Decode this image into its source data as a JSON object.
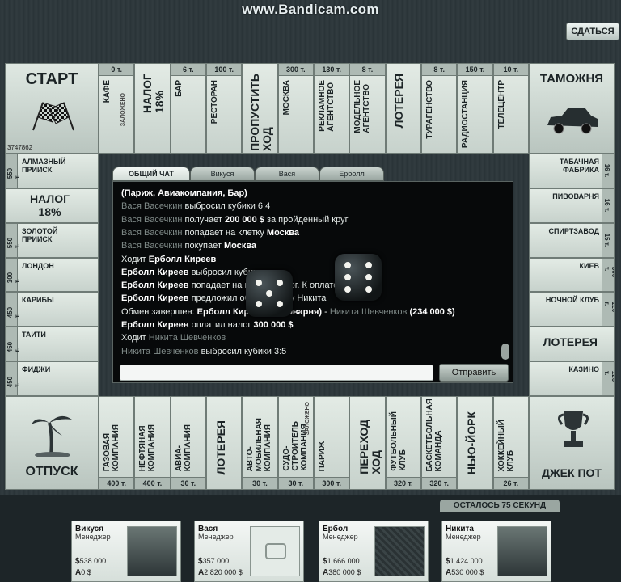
{
  "watermark": "www.Bandicam.com",
  "surrender_label": "СДАТЬСЯ",
  "corners": {
    "start": "СТАРТ",
    "start_counter": "3747862",
    "customs": "ТАМОЖНЯ",
    "vacation": "ОТПУСК",
    "jackpot": "ДЖЕК ПОТ"
  },
  "top_cells": [
    {
      "price": "0 т.",
      "name": "КАФЕ",
      "note": "ЗАЛОЖЕНО"
    },
    {
      "price": "",
      "name": "НАЛОГ\n18%"
    },
    {
      "price": "6 т.",
      "name": "БАР"
    },
    {
      "price": "100 т.",
      "name": "РЕСТОРАН"
    },
    {
      "price": "",
      "name": "ПРОПУСТИТЬ\nХОД"
    },
    {
      "price": "300 т.",
      "name": "МОСКВА"
    },
    {
      "price": "130 т.",
      "name": "РЕКЛАМНОЕ\nАГЕНТСТВО"
    },
    {
      "price": "8 т.",
      "name": "МОДЕЛЬНОЕ\nАГЕНТСТВО"
    },
    {
      "price": "",
      "name": "ЛОТЕРЕЯ"
    },
    {
      "price": "8 т.",
      "name": "ТУРАГЕНСТВО"
    },
    {
      "price": "150 т.",
      "name": "РАДИОСТАНЦИЯ"
    },
    {
      "price": "10 т.",
      "name": "ТЕЛЕЦЕНТР"
    }
  ],
  "left_cells": [
    {
      "price": "550 т.",
      "name": "АЛМАЗНЫЙ\nПРИИСК"
    },
    {
      "price": "",
      "name": "НАЛОГ\n18%"
    },
    {
      "price": "550 т.",
      "name": "ЗОЛОТОЙ\nПРИИСК"
    },
    {
      "price": "300 т.",
      "name": "ЛОНДОН"
    },
    {
      "price": "450 т.",
      "name": "КАРИБЫ"
    },
    {
      "price": "450 т.",
      "name": "ТАИТИ"
    },
    {
      "price": "450 т.",
      "name": "ФИДЖИ"
    }
  ],
  "right_cells": [
    {
      "price": "16 т.",
      "name": "ТАБАЧНАЯ\nФАБРИКА"
    },
    {
      "price": "16 т.",
      "name": "ПИВОВАРНЯ"
    },
    {
      "price": "15 т.",
      "name": "СПИРТЗАВОД"
    },
    {
      "price": "300 т.",
      "name": "КИЕВ"
    },
    {
      "price": "120 т.",
      "name": "НОЧНОЙ КЛУБ"
    },
    {
      "price": "",
      "name": "ЛОТЕРЕЯ"
    },
    {
      "price": "120 т.",
      "name": "КАЗИНО"
    }
  ],
  "bottom_cells": [
    {
      "price": "400 т.",
      "name": "ГАЗОВАЯ\nКОМПАНИЯ"
    },
    {
      "price": "400 т.",
      "name": "НЕФТЯНАЯ\nКОМПАНИЯ"
    },
    {
      "price": "30 т.",
      "name": "АВИА-\nКОМПАНИЯ"
    },
    {
      "price": "",
      "name": "ЛОТЕРЕЯ"
    },
    {
      "price": "30 т.",
      "name": "АВТО-\nМОБИЛЬНАЯ\nКОМПАНИЯ"
    },
    {
      "price": "30 т.",
      "name": "СУДО-\nСТРОИТЕЛЬ\nКОМПАНИЯ",
      "note": "ЗАЛОЖЕНО"
    },
    {
      "price": "300 т.",
      "name": "ПАРИЖ"
    },
    {
      "price": "",
      "name": "ПЕРЕХОД\nХОД"
    },
    {
      "price": "320 т.",
      "name": "ФУТБОЛЬНЫЙ\nКЛУБ"
    },
    {
      "price": "320 т.",
      "name": "БАСКЕТБОЛЬНАЯ\nКОМАНДА"
    },
    {
      "price": "",
      "name": "НЬЮ-ЙОРК"
    },
    {
      "price": "26 т.",
      "name": "ХОККЕЙНЫЙ\nКЛУБ"
    }
  ],
  "chat": {
    "tabs": [
      "ОБЩИЙ ЧАТ",
      "Викуся",
      "Вася",
      "Ерболл"
    ],
    "messages": [
      {
        "parts": [
          [
            "b",
            "(Париж, Авиакомпания, Бар)"
          ]
        ]
      },
      {
        "parts": [
          [
            "g",
            "Вася Васечкин "
          ],
          [
            "n",
            "выбросил кубики 6:4"
          ]
        ]
      },
      {
        "parts": [
          [
            "g",
            "Вася Васечкин "
          ],
          [
            "n",
            "получает "
          ],
          [
            "b",
            "200 000 $"
          ],
          [
            "n",
            " за пройденный круг"
          ]
        ]
      },
      {
        "parts": [
          [
            "g",
            "Вася Васечкин "
          ],
          [
            "n",
            "попадает на клетку "
          ],
          [
            "b",
            "Москва"
          ]
        ]
      },
      {
        "parts": [
          [
            "g",
            "Вася Васечкин "
          ],
          [
            "n",
            "покупает "
          ],
          [
            "b",
            "Москва"
          ]
        ]
      },
      {
        "parts": [
          [
            "n",
            "Ходит "
          ],
          [
            "b",
            "Ерболл Киреев"
          ]
        ]
      },
      {
        "parts": [
          [
            "b",
            "Ерболл Киреев"
          ],
          [
            "n",
            " выбросил кубики"
          ]
        ]
      },
      {
        "parts": [
          [
            "b",
            "Ерболл Киреев"
          ],
          [
            "n",
            " попадает на клетку Налог. К оплате $"
          ]
        ]
      },
      {
        "parts": [
          [
            "b",
            "Ерболл Киреев"
          ],
          [
            "n",
            " предложил обмен игроку Никита"
          ]
        ]
      },
      {
        "parts": [
          [
            "n",
            "Обмен завершен: "
          ],
          [
            "b",
            "Ерболл Киреев (Пивоварня)"
          ],
          [
            "n",
            " - "
          ],
          [
            "g",
            "Никита Шевченков "
          ],
          [
            "b",
            "(234 000 $)"
          ]
        ]
      },
      {
        "parts": [
          [
            "b",
            "Ерболл Киреев"
          ],
          [
            "n",
            " оплатил налог "
          ],
          [
            "b",
            "300 000 $"
          ]
        ]
      },
      {
        "parts": [
          [
            "n",
            "Ходит "
          ],
          [
            "g",
            "Никита Шевченков"
          ]
        ]
      },
      {
        "parts": [
          [
            "g",
            "Никита Шевченков "
          ],
          [
            "n",
            "выбросил кубики 3:5"
          ]
        ]
      }
    ],
    "input_placeholder": "",
    "send_label": "Отправить"
  },
  "dice": [
    5,
    6
  ],
  "timer": "ОСТАЛОСЬ 75 СЕКУНД",
  "players": [
    {
      "name": "Викуся",
      "role": "Менеджер",
      "money": "538 000",
      "assets": "0 $"
    },
    {
      "name": "Вася",
      "role": "Менеджер",
      "money": "357 000",
      "assets": "2 820 000 $"
    },
    {
      "name": "Ербол",
      "role": "Менеджер",
      "money": "1 666 000",
      "assets": "380 000 $"
    },
    {
      "name": "Никита",
      "role": "Менеджер",
      "money": "1 424 000",
      "assets": "530 000 $"
    }
  ],
  "icons": {
    "money": "$",
    "assets": "A"
  }
}
